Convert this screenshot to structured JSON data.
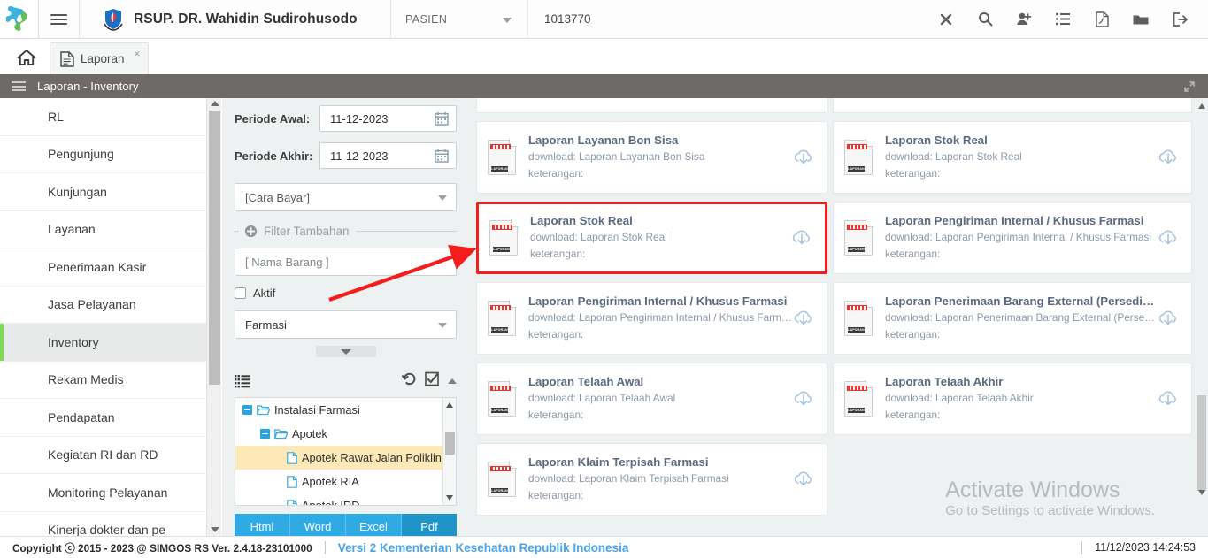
{
  "topbar": {
    "hospital_name": "RSUP. DR. Wahidin Sudirohusodo",
    "patient_selector_label": "PASIEN",
    "patient_number": "1013770",
    "icons": [
      {
        "name": "close-icon",
        "glyph": "x"
      },
      {
        "name": "search-icon",
        "glyph": "search"
      },
      {
        "name": "add-user-icon",
        "glyph": "user-plus"
      },
      {
        "name": "list-icon",
        "glyph": "list"
      },
      {
        "name": "pdf-icon",
        "glyph": "pdf"
      },
      {
        "name": "folder-icon",
        "glyph": "folder"
      },
      {
        "name": "logout-icon",
        "glyph": "logout"
      }
    ]
  },
  "tabs": {
    "home_label": "Home",
    "items": [
      {
        "label": "Laporan",
        "close": "×"
      }
    ]
  },
  "breadcrumb": {
    "text": "Laporan - Inventory"
  },
  "sidebar": {
    "items": [
      {
        "label": "RL",
        "active": false
      },
      {
        "label": "Pengunjung",
        "active": false
      },
      {
        "label": "Kunjungan",
        "active": false
      },
      {
        "label": "Layanan",
        "active": false
      },
      {
        "label": "Penerimaan Kasir",
        "active": false
      },
      {
        "label": "Jasa Pelayanan",
        "active": false
      },
      {
        "label": "Inventory",
        "active": true
      },
      {
        "label": "Rekam Medis",
        "active": false
      },
      {
        "label": "Pendapatan",
        "active": false
      },
      {
        "label": "Kegiatan RI dan RD",
        "active": false
      },
      {
        "label": "Monitoring Pelayanan",
        "active": false
      },
      {
        "label": "Kinerja dokter dan pe",
        "active": false
      }
    ]
  },
  "filters": {
    "periode_awal_label": "Periode Awal:",
    "periode_awal_value": "11-12-2023",
    "periode_akhir_label": "Periode Akhir:",
    "periode_akhir_value": "11-12-2023",
    "cara_bayar_value": "[Cara Bayar]",
    "filter_tambahan_label": "Filter Tambahan",
    "nama_barang_placeholder": "[ Nama Barang ]",
    "aktif_label": "Aktif",
    "unit_value": "Farmasi",
    "tree": {
      "nodes": [
        {
          "label": "Instalasi Farmasi",
          "level": 0,
          "type": "folder",
          "expander": "minus",
          "selected": false
        },
        {
          "label": "Apotek",
          "level": 1,
          "type": "folder",
          "expander": "minus",
          "selected": false
        },
        {
          "label": "Apotek Rawat Jalan Poliklin...",
          "level": 2,
          "type": "file",
          "expander": "none",
          "selected": true
        },
        {
          "label": "Apotek RIA",
          "level": 2,
          "type": "file",
          "expander": "none",
          "selected": false
        },
        {
          "label": "Apotek IRD",
          "level": 2,
          "type": "file",
          "expander": "none",
          "selected": false
        }
      ]
    },
    "export_buttons": [
      {
        "label": "Html",
        "selected": false
      },
      {
        "label": "Word",
        "selected": false
      },
      {
        "label": "Excel",
        "selected": false
      },
      {
        "label": "Pdf",
        "selected": true
      }
    ]
  },
  "reports": {
    "download_prefix": "download: ",
    "keterangan_label": "keterangan:",
    "left_column": [
      {
        "title": "",
        "download": "",
        "keterangan": "",
        "stub": true,
        "highlight": false
      },
      {
        "title": "Laporan Layanan Bon Sisa",
        "download": "download: Laporan Layanan Bon Sisa",
        "keterangan": "keterangan:",
        "stub": false,
        "highlight": false
      },
      {
        "title": "Laporan Stok Real",
        "download": "download: Laporan Stok Real",
        "keterangan": "keterangan:",
        "stub": false,
        "highlight": true
      },
      {
        "title": "Laporan Pengiriman Internal / Khusus Farmasi",
        "download": "download: Laporan Pengiriman Internal / Khusus Farmasi",
        "keterangan": "keterangan:",
        "stub": false,
        "highlight": false
      },
      {
        "title": "Laporan Telaah Awal",
        "download": "download: Laporan Telaah Awal",
        "keterangan": "keterangan:",
        "stub": false,
        "highlight": false
      },
      {
        "title": "Laporan Klaim Terpisah Farmasi",
        "download": "download: Laporan Klaim Terpisah Farmasi",
        "keterangan": "keterangan:",
        "stub": false,
        "highlight": false
      }
    ],
    "right_column": [
      {
        "title": "",
        "download": "",
        "keterangan": "",
        "stub": true,
        "highlight": false
      },
      {
        "title": "Laporan Stok Real",
        "download": "download: Laporan Stok Real",
        "keterangan": "keterangan:",
        "stub": false,
        "highlight": false
      },
      {
        "title": "Laporan Pengiriman Internal / Khusus Farmasi",
        "download": "download: Laporan Pengiriman Internal / Khusus Farmasi",
        "keterangan": "keterangan:",
        "stub": false,
        "highlight": false
      },
      {
        "title": "Laporan Penerimaan Barang External (Persediaan)",
        "download": "download: Laporan Penerimaan Barang External (Persediaan)",
        "keterangan": "keterangan:",
        "stub": false,
        "highlight": false
      },
      {
        "title": "Laporan Telaah Akhir",
        "download": "download: Laporan Telaah Akhir",
        "keterangan": "keterangan:",
        "stub": false,
        "highlight": false
      }
    ],
    "icon_label": "LAPORAN"
  },
  "watermark": {
    "line1": "Activate Windows",
    "line2": "Go to Settings to activate Windows."
  },
  "footer": {
    "copyright": "Copyright ⓒ 2015 - 2023 @ SIMGOS RS Ver. 2.4.18-23101000",
    "versi": "Versi 2 Kementerian Kesehatan Republik Indonesia",
    "datetime": "11/12/2023 14:24:53"
  },
  "colors": {
    "accent_blue": "#2eabe2",
    "highlight_red": "#f41d1d",
    "active_green": "#7ed957",
    "breadcrumb_gray": "#6e6a67",
    "card_title": "#5b6a80"
  }
}
